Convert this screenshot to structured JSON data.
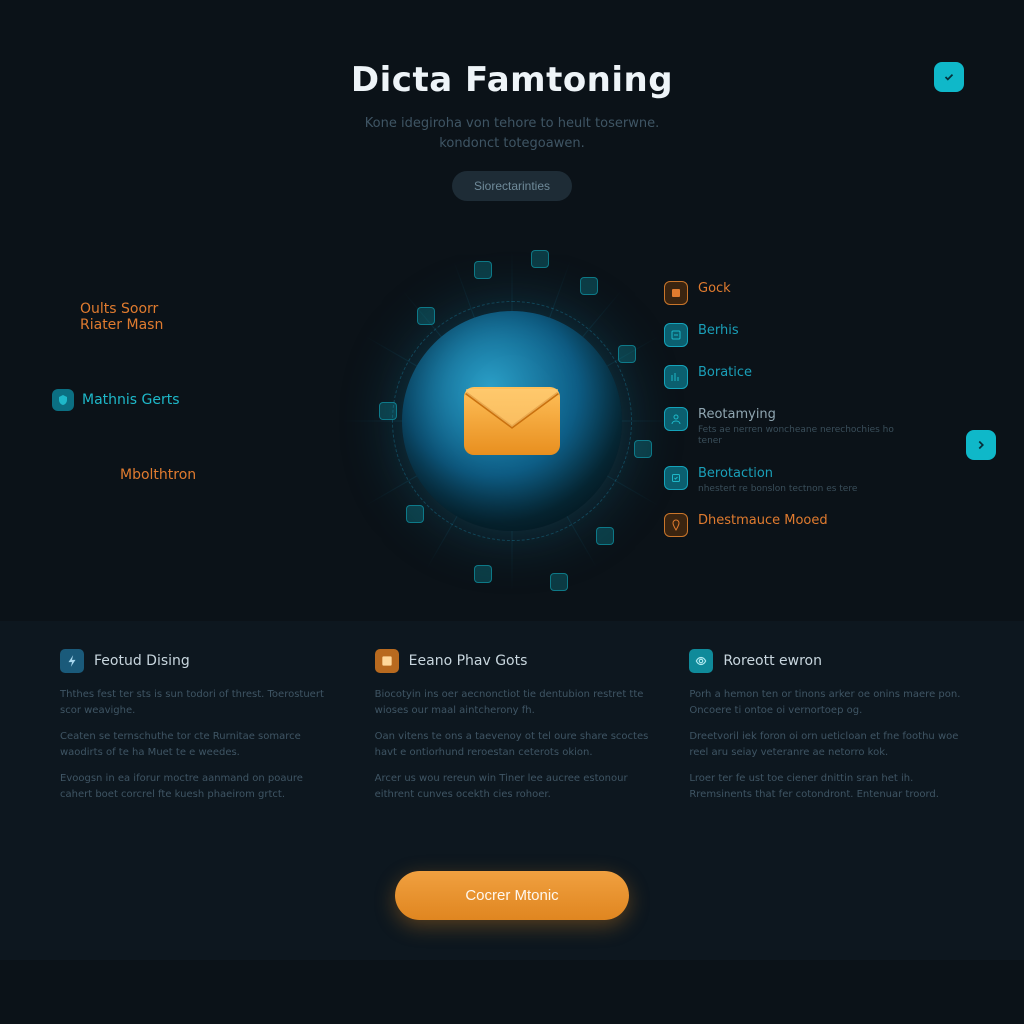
{
  "hero": {
    "title": "Dicta Famtoning",
    "subtitle1": "Kone idegiroha von tehore to heult toserwne.",
    "subtitle2": "kondonct totegoawen.",
    "button": "Siorectarinties"
  },
  "left": {
    "l1a": "Oults Soorr",
    "l1b": "Riater Masn",
    "l2": "Mathnis Gerts",
    "l3": "Mbolthtron"
  },
  "right": {
    "items": [
      {
        "title": "Gock",
        "sub": "",
        "color": "orange",
        "icon": "orange"
      },
      {
        "title": "Berhis",
        "sub": "",
        "color": "teal",
        "icon": "teal"
      },
      {
        "title": "Boratice",
        "sub": "",
        "color": "teal",
        "icon": "teal"
      },
      {
        "title": "Reotamying",
        "sub": "Fets ae nerren woncheane nerechochies ho tener",
        "color": "grey",
        "icon": "teal"
      },
      {
        "title": "Berotaction",
        "sub": "nhestert re bonslon tectnon es tere",
        "color": "teal",
        "icon": "teal"
      },
      {
        "title": "Dhestmauce Mooed",
        "sub": "",
        "color": "orange",
        "icon": "orange"
      }
    ]
  },
  "features": [
    {
      "title": "Feotud Dising",
      "p1": "Ththes fest ter sts is sun todori of threst. Toerostuert scor weavighe.",
      "p2": "Ceaten se ternschuthe tor cte Rurnitae somarce waodirts of te ha Muet te e weedes.",
      "p3": "Evoogsn in ea iforur moctre aanmand on poaure cahert boet corcrel fte kuesh phaeirom grtct."
    },
    {
      "title": "Eeano Phav Gots",
      "p1": "Biocotyin ins oer aecnonctiot tie dentubion restret tte wioses our maal aintcherony fh.",
      "p2": "Oan vitens te ons a taevenoy ot tel oure share scoctes havt e ontiorhund reroestan ceterots okion.",
      "p3": "Arcer us wou rereun win Tiner lee aucree estonour eithrent cunves ocekth cies rohoer."
    },
    {
      "title": "Roreott ewron",
      "p1": "Porh a hemon ten or tinons arker oe onins maere pon. Oncoere ti ontoe oi vernortoep og.",
      "p2": "Dreetvoril iek foron oi orn ueticloan et fne foothu woe reel aru seiay veteranre ae netorro kok.",
      "p3": "Lroer ter fe ust toe ciener dnittin sran het ih. Rremsinents that fer cotondront. Entenuar troord."
    }
  ],
  "cta": "Cocrer Mtonic"
}
